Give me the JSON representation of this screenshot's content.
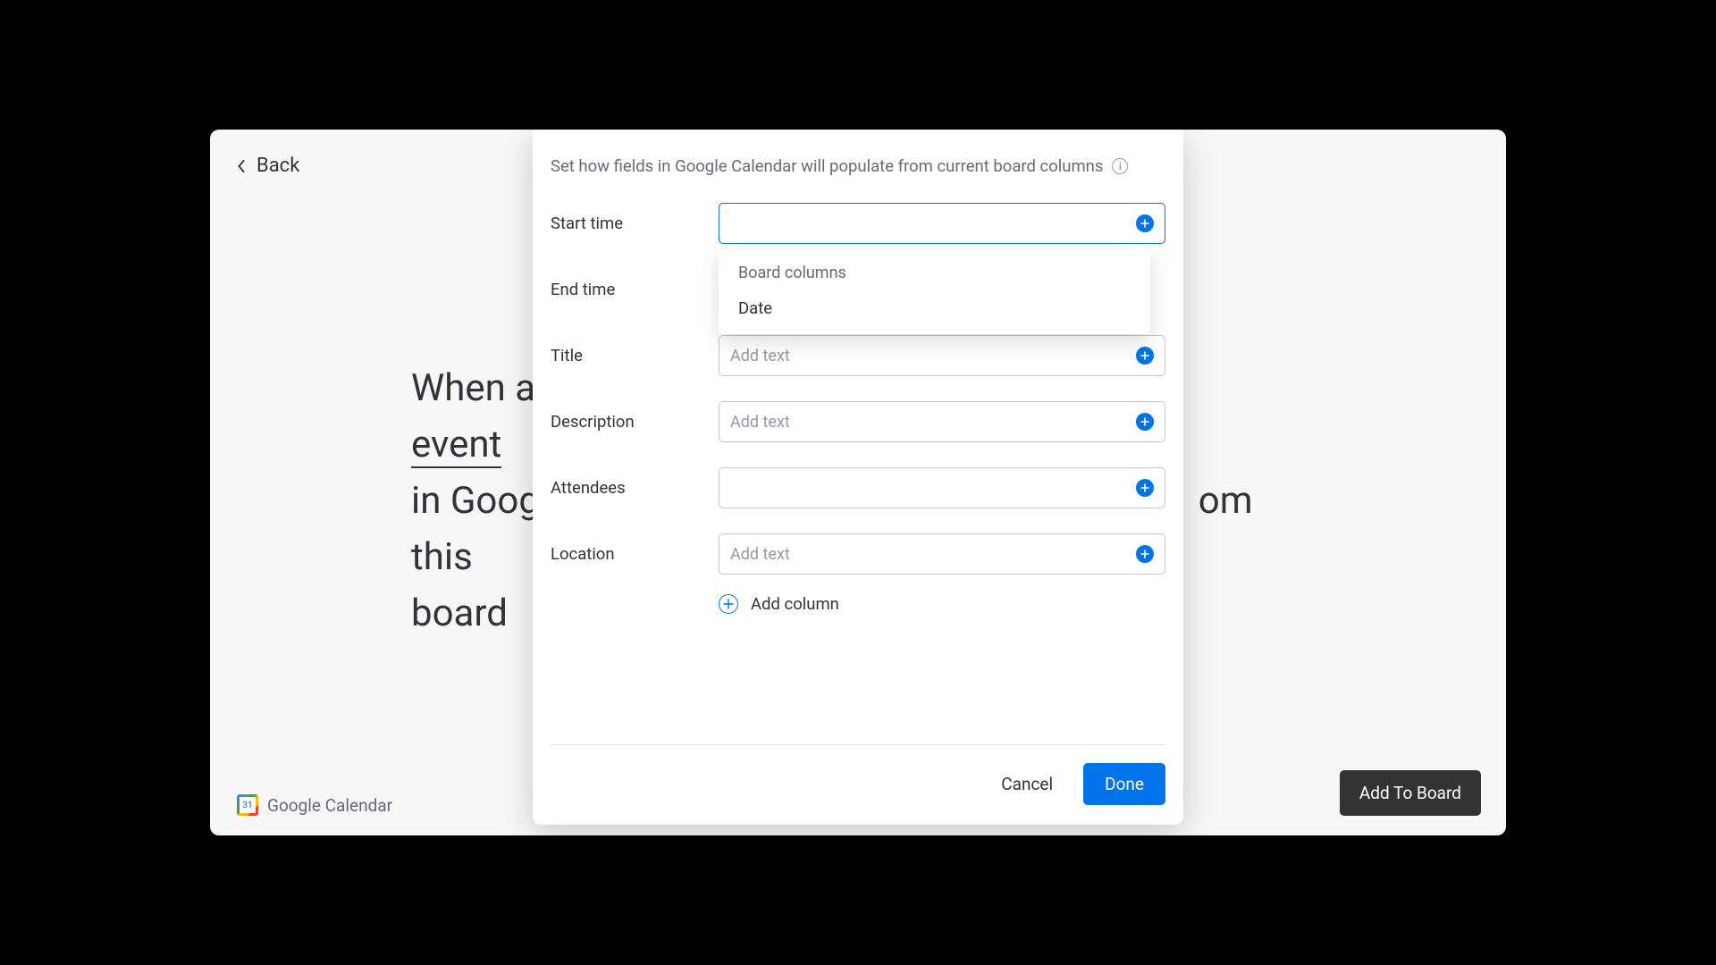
{
  "back_label": "Back",
  "bg_sentence": {
    "part1": "When a",
    "part2": "event",
    "part3": "in Goog",
    "part4": "om this",
    "part5": "board"
  },
  "gcal_footer": "Google Calendar",
  "add_to_board": "Add To Board",
  "modal": {
    "header": "Set how fields in Google Calendar will populate from current board columns",
    "fields": [
      {
        "label": "Start time",
        "placeholder": "",
        "active": true
      },
      {
        "label": "End time",
        "placeholder": ""
      },
      {
        "label": "Title",
        "placeholder": "Add text"
      },
      {
        "label": "Description",
        "placeholder": "Add text"
      },
      {
        "label": "Attendees",
        "placeholder": ""
      },
      {
        "label": "Location",
        "placeholder": "Add text"
      }
    ],
    "dropdown": {
      "header": "Board columns",
      "items": [
        "Date"
      ]
    },
    "add_column": "Add column",
    "cancel": "Cancel",
    "done": "Done"
  }
}
